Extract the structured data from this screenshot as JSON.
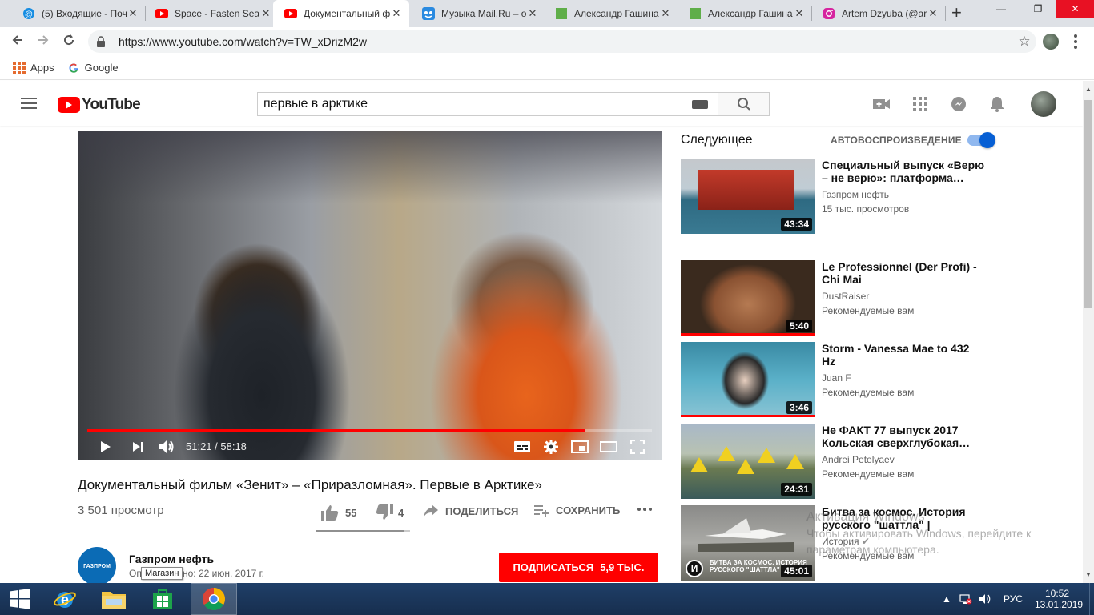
{
  "browser": {
    "tabs": [
      {
        "label": "(5) Входящие - Поч",
        "icon": "mail-icon",
        "active": false
      },
      {
        "label": "Space - Fasten Seat",
        "icon": "youtube-icon",
        "active": false
      },
      {
        "label": "Документальный ф",
        "icon": "youtube-icon",
        "active": true
      },
      {
        "label": "Музыка Mail.Ru – о",
        "icon": "mail-music-icon",
        "active": false
      },
      {
        "label": "Александр Гашина",
        "icon": "green-square-icon",
        "active": false
      },
      {
        "label": "Александр Гашина",
        "icon": "green-square-icon",
        "active": false
      },
      {
        "label": "Artem Dzyuba (@ar",
        "icon": "instagram-icon",
        "active": false
      }
    ],
    "new_tab": "+",
    "window_controls": {
      "minimize": "—",
      "maximize": "❐",
      "close": "✕"
    },
    "url": "https://www.youtube.com/watch?v=TW_xDrizM2w",
    "bookmarks": [
      {
        "label": "Apps",
        "icon": "apps-grid-icon"
      },
      {
        "label": "Google",
        "icon": "google-icon"
      }
    ]
  },
  "youtube": {
    "logo_text": "YouTube",
    "search_value": "первые в арктике",
    "player": {
      "time": "51:21 / 58:18",
      "progress_fraction": 0.881
    },
    "video": {
      "title": "Документальный фильм «Зенит» – «Приразломная». Первые в Арктике»",
      "views": "3 501 просмотр",
      "likes": "55",
      "dislikes": "4",
      "share": "ПОДЕЛИТЬСЯ",
      "save": "СОХРАНИТЬ",
      "like_ratio": 0.93
    },
    "channel": {
      "name": "Газпром нефть",
      "avatar_text": "ГАЗПРОМ",
      "published": "Опубликовано: 22 июн. 2017 г.",
      "tooltip": "Магазин",
      "subscribe": "ПОДПИСАТЬСЯ",
      "subscribers": "5,9 ТЫС."
    },
    "sidebar": {
      "next_label": "Следующее",
      "autoplay_label": "АВТОВОСПРОИЗВЕДЕНИЕ",
      "autoplay_on": true,
      "items": [
        {
          "title": "Специальный выпуск «Верю – не верю»: платформа…",
          "channel": "Газпром нефть",
          "meta": "15 тыс. просмотров",
          "duration": "43:34"
        },
        {
          "title": "Le Professionnel (Der Profi) - Chi Mai",
          "channel": "DustRaiser",
          "meta": "Рекомендуемые вам",
          "duration": "5:40"
        },
        {
          "title": "Storm - Vanessa Mae to 432 Hz",
          "channel": "Juan F",
          "meta": "Рекомендуемые вам",
          "duration": "3:46"
        },
        {
          "title": "Не ФАКТ 77 выпуск 2017 Кольская сверхглубокая…",
          "channel": "Andrei Petelyaev",
          "meta": "Рекомендуемые вам",
          "duration": "24:31"
        },
        {
          "title": "Битва за космос. История русского \"шаттла\" | Телекана…",
          "channel": "История",
          "meta": "Рекомендуемые вам",
          "duration": "45:01",
          "thumb_caption": "БИТВА ЗА КОСМОС. ИСТОРИЯ РУССКОГО \"ШАТТЛА\"",
          "thumb_logo": "И"
        }
      ]
    }
  },
  "windows_watermark": {
    "line1": "Активация Windows",
    "line2": "Чтобы активировать Windows, перейдите к",
    "line3": "параметрам компьютера."
  },
  "taskbar": {
    "language": "РУС",
    "time": "10:52",
    "date": "13.01.2019"
  },
  "colors": {
    "youtube_red": "#ff0000",
    "autoplay_blue": "#065fd4",
    "taskbar": "#1f3f68"
  }
}
